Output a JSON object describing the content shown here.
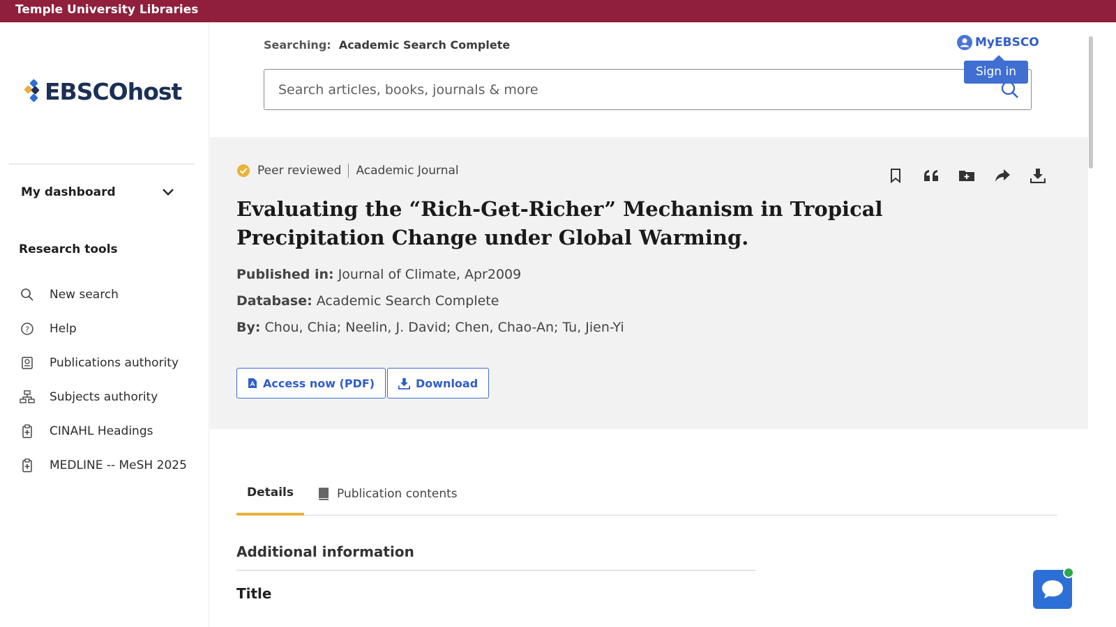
{
  "top_bar": {
    "institution": "Temple University Libraries"
  },
  "logo": {
    "text": "EBSCOhost"
  },
  "sidebar": {
    "dashboard_label": "My dashboard",
    "research_tools_title": "Research tools",
    "tools": [
      {
        "label": "New search",
        "icon": "search-icon"
      },
      {
        "label": "Help",
        "icon": "help-icon"
      },
      {
        "label": "Publications authority",
        "icon": "publications-icon"
      },
      {
        "label": "Subjects authority",
        "icon": "subjects-hierarchy-icon"
      },
      {
        "label": "CINAHL Headings",
        "icon": "clipboard-medical-icon"
      },
      {
        "label": "MEDLINE -- MeSH 2025",
        "icon": "clipboard-medical-icon"
      }
    ]
  },
  "search": {
    "searching_label": "Searching:",
    "database": "Academic Search Complete",
    "placeholder": "Search articles, books, journals & more"
  },
  "account": {
    "myebsco_label": "MyEBSCO",
    "signin_label": "Sign in"
  },
  "record": {
    "peer_reviewed": "Peer reviewed",
    "source_type": "Academic Journal",
    "title": "Evaluating the “Rich-Get-Richer” Mechanism in Tropical Precipitation Change under Global Warming.",
    "published_label": "Published in:",
    "published_value": "Journal of Climate, Apr2009",
    "database_label": "Database:",
    "database_value": "Academic Search Complete",
    "by_label": "By:",
    "authors": "Chou, Chia; Neelin, J. David; Chen, Chao-An; Tu, Jien-Yi",
    "access_button": "Access now (PDF)",
    "download_button": "Download",
    "action_icons": [
      "bookmark-icon",
      "cite-quote-icon",
      "add-to-folder-icon",
      "share-icon",
      "download-icon"
    ]
  },
  "tabs": {
    "details": "Details",
    "publication_contents": "Publication contents"
  },
  "details": {
    "additional_info": "Additional information",
    "title_label": "Title"
  },
  "colors": {
    "top_bar": "#8f1f3a",
    "accent_blue": "#3f6fd0",
    "tab_underline": "#e8b33a",
    "record_bg": "#f2f2f2"
  }
}
